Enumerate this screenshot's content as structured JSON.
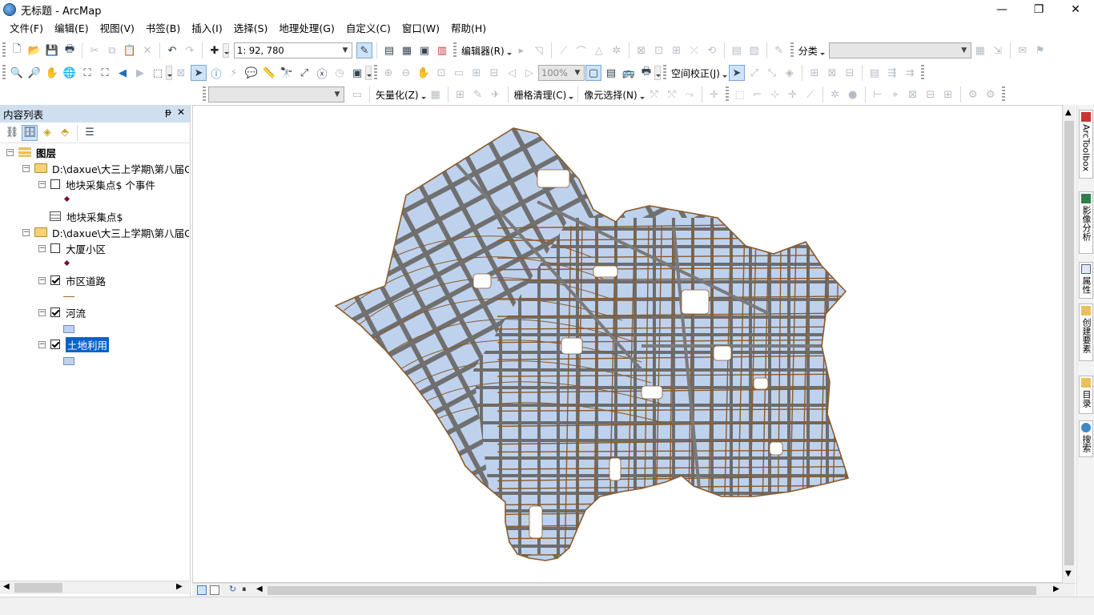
{
  "window": {
    "title": "无标题 - ArcMap",
    "minimize": "—",
    "maximize": "❐",
    "close": "✕"
  },
  "menu": [
    "文件(F)",
    "编辑(E)",
    "视图(V)",
    "书签(B)",
    "插入(I)",
    "选择(S)",
    "地理处理(G)",
    "自定义(C)",
    "窗口(W)",
    "帮助(H)"
  ],
  "toolbar1": {
    "scale": "1: 92, 780",
    "editor": "编辑器(R)",
    "classify": "分类"
  },
  "toolbar2": {
    "zoom_percent": "100%",
    "spatial_adjust": "空间校正(J)"
  },
  "toolbar3": {
    "vectorize": "矢量化(Z)",
    "raster_cleanup": "栅格清理(C)",
    "pixel_select": "像元选择(N)"
  },
  "toc": {
    "title": "内容列表",
    "pin": "ᵽ",
    "close": "✕",
    "root": "图层",
    "groups": [
      {
        "folder": "D:\\daxue\\大三上学期\\第八届G",
        "layers": [
          {
            "name": "地块采集点$ 个事件",
            "checked": false,
            "symbol": "point"
          },
          {
            "name": "地块采集点$",
            "type": "table"
          }
        ]
      },
      {
        "folder": "D:\\daxue\\大三上学期\\第八届G",
        "layers": [
          {
            "name": "大厦小区",
            "checked": false,
            "symbol": "point"
          },
          {
            "name": "市区道路",
            "checked": true,
            "symbol": "line"
          },
          {
            "name": "河流",
            "checked": true,
            "symbol": "polygon"
          },
          {
            "name": "土地利用",
            "checked": true,
            "symbol": "polygon",
            "selected": true
          }
        ]
      }
    ]
  },
  "dock_tabs": [
    "ArcToolbox",
    "影像分析",
    "属性",
    "创建要素",
    "目录",
    "搜索"
  ],
  "colors": {
    "parcel_fill": "#bed2ee",
    "road": "#8a5a2b",
    "road_casing": "#6e6e6e",
    "toc_header": "#cfdff0",
    "selection": "#0a62c9"
  }
}
